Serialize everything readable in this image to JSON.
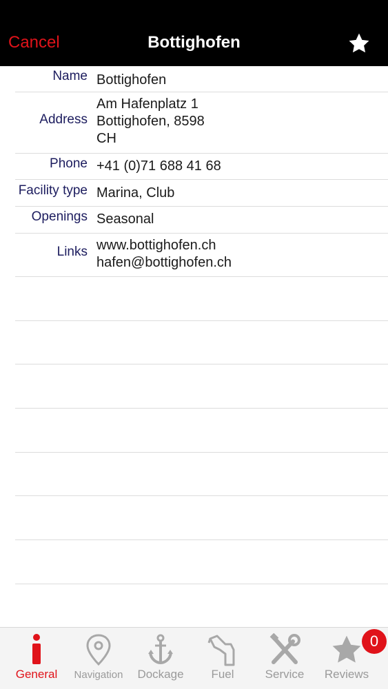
{
  "nav": {
    "cancel_label": "Cancel",
    "title": "Bottighofen"
  },
  "details": {
    "name_label": "Name",
    "name_value": "Bottighofen",
    "address_label": "Address",
    "address_line1": "Am Hafenplatz 1",
    "address_line2": "Bottighofen, 8598",
    "address_line3": "CH",
    "phone_label": "Phone",
    "phone_value": "+41 (0)71 688 41 68",
    "facility_label": "Facility type",
    "facility_value": "Marina, Club",
    "openings_label": "Openings",
    "openings_value": "Seasonal",
    "links_label": "Links",
    "link_web": "www.bottighofen.ch",
    "link_email": "hafen@bottighofen.ch"
  },
  "tabs": [
    {
      "label": "General",
      "icon": "info-icon",
      "active": true
    },
    {
      "label": "Navigation",
      "icon": "location-pin-icon",
      "active": false
    },
    {
      "label": "Dockage",
      "icon": "anchor-icon",
      "active": false
    },
    {
      "label": "Fuel",
      "icon": "fuel-nozzle-icon",
      "active": false
    },
    {
      "label": "Service",
      "icon": "tools-icon",
      "active": false
    },
    {
      "label": "Reviews",
      "icon": "star-icon",
      "active": false
    }
  ],
  "reviews_badge": "0",
  "colors": {
    "accent": "#e0131a",
    "navbar_bg": "#000000",
    "label_text": "#1c1c5e",
    "inactive_tab": "#9a9a9a"
  }
}
